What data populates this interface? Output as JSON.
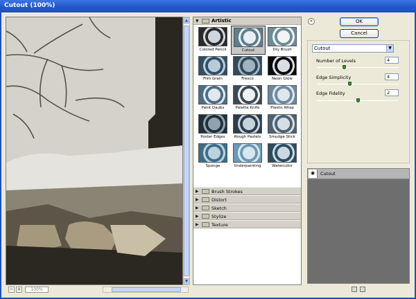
{
  "window": {
    "title": "Cutout (100%)"
  },
  "zoom": {
    "minus": "−",
    "plus": "+",
    "value": "100%"
  },
  "buttons": {
    "ok": "OK",
    "cancel": "Cancel"
  },
  "gallery": {
    "open_category": "Artistic",
    "filters": [
      "Colored Pencil",
      "Cutout",
      "Dry Brush",
      "Film Grain",
      "Fresco",
      "Neon Glow",
      "Paint Daubs",
      "Palette Knife",
      "Plastic Wrap",
      "Poster Edges",
      "Rough Pastels",
      "Smudge Stick",
      "Sponge",
      "Underpainting",
      "Watercolor"
    ],
    "selected_filter": "Cutout",
    "categories": [
      "Brush Strokes",
      "Distort",
      "Sketch",
      "Stylize",
      "Texture"
    ]
  },
  "settings": {
    "filter_select": "Cutout",
    "params": [
      {
        "label": "Number of Levels",
        "value": "4",
        "slider_fraction": 0.33
      },
      {
        "label": "Edge Simplicity",
        "value": "4",
        "slider_fraction": 0.4
      },
      {
        "label": "Edge Fidelity",
        "value": "2",
        "slider_fraction": 0.5
      }
    ]
  },
  "layers": {
    "items": [
      {
        "name": "Cutout",
        "visible": true
      }
    ]
  },
  "icons": {
    "collapse": "double-chevron-up-icon",
    "eye": "eye-icon",
    "new_layer": "new-effect-layer-icon",
    "delete": "trash-icon",
    "dropdown": "chevron-down-icon",
    "folder": "folder-icon"
  }
}
